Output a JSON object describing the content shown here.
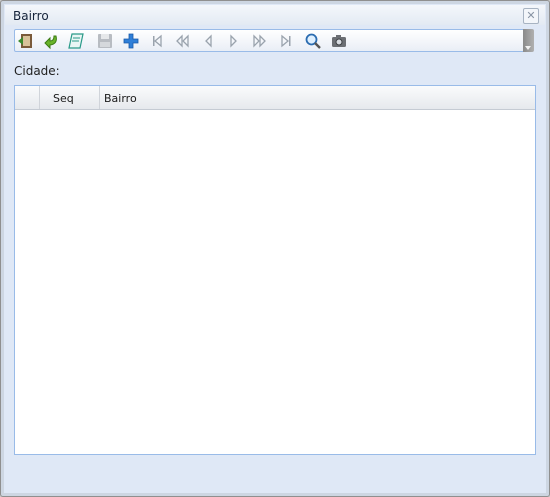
{
  "window": {
    "title": "Bairro",
    "close_symbol": "✕"
  },
  "toolbar": {
    "buttons": [
      {
        "name": "exit",
        "icon": "exit-door-icon",
        "enabled": true
      },
      {
        "name": "undo",
        "icon": "undo-arrow-icon",
        "enabled": true
      },
      {
        "name": "edit",
        "icon": "edit-sheet-icon",
        "enabled": true
      },
      {
        "name": "save",
        "icon": "floppy-disk-icon",
        "enabled": false
      },
      {
        "name": "add",
        "icon": "plus-icon",
        "enabled": true
      },
      {
        "name": "first",
        "icon": "first-record-icon",
        "enabled": false
      },
      {
        "name": "previous-page",
        "icon": "previous-page-icon",
        "enabled": false
      },
      {
        "name": "previous",
        "icon": "previous-record-icon",
        "enabled": false
      },
      {
        "name": "next",
        "icon": "next-record-icon",
        "enabled": false
      },
      {
        "name": "next-page",
        "icon": "next-page-icon",
        "enabled": false
      },
      {
        "name": "last",
        "icon": "last-record-icon",
        "enabled": false
      },
      {
        "name": "search",
        "icon": "magnifier-icon",
        "enabled": true
      },
      {
        "name": "photo",
        "icon": "camera-icon",
        "enabled": true
      }
    ]
  },
  "form": {
    "cidade_label": "Cidade:"
  },
  "grid": {
    "columns": [
      "",
      "Seq",
      "Bairro"
    ],
    "rows": []
  },
  "colors": {
    "accent_blue": "#2f7fd8",
    "panel_bg": "#dfe8f6",
    "border_blue": "#99bbe8"
  }
}
